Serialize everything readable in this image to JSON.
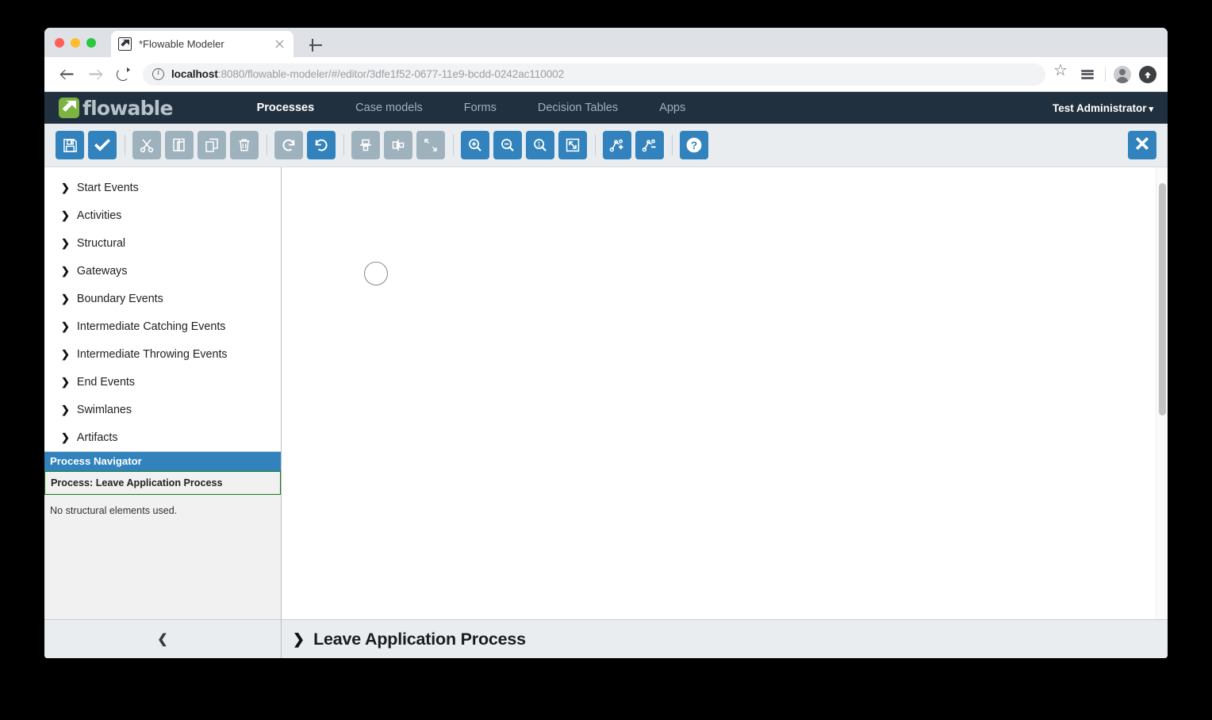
{
  "browser": {
    "tab": {
      "title": "*Flowable Modeler",
      "favicon_icon": "flowable-favicon-icon",
      "close_icon": "close-icon"
    },
    "new_tab_icon": "plus-icon",
    "back_icon": "arrow-left-icon",
    "forward_icon": "arrow-right-icon",
    "reload_icon": "reload-icon",
    "site_info_icon": "info-circle-icon",
    "url_host": "localhost",
    "url_path": ":8080/flowable-modeler/#/editor/3dfe1f52-0677-11e9-bcdd-0242ac110002",
    "bookmark_icon": "star-icon",
    "extension_icon": "extensions-stack-icon",
    "profile_icon": "avatar-icon",
    "update_icon": "update-arrow-icon"
  },
  "navbar": {
    "logo_text": "flowable",
    "logo_icon": "flowable-logo-icon",
    "items": [
      {
        "label": "Processes",
        "active": true
      },
      {
        "label": "Case models",
        "active": false
      },
      {
        "label": "Forms",
        "active": false
      },
      {
        "label": "Decision Tables",
        "active": false
      },
      {
        "label": "Apps",
        "active": false
      }
    ],
    "user": "Test Administrator",
    "user_caret_icon": "chevron-down-icon",
    "background_color": "#21303f",
    "accent_color": "#7cb342"
  },
  "toolbar": {
    "enabled_color": "#3182bd",
    "disabled_color": "#9eb2bd",
    "background_color": "#e9edf0",
    "buttons": [
      {
        "name": "save-button",
        "icon": "floppy-disk-icon",
        "enabled": true,
        "title": "Save"
      },
      {
        "name": "validate-button",
        "icon": "check-icon",
        "enabled": true,
        "title": "Validate"
      },
      {
        "separator": true
      },
      {
        "name": "cut-button",
        "icon": "scissors-icon",
        "enabled": false,
        "title": "Cut"
      },
      {
        "name": "copy-button",
        "icon": "copy-icon",
        "enabled": false,
        "title": "Copy"
      },
      {
        "name": "paste-button",
        "icon": "paste-icon",
        "enabled": false,
        "title": "Paste"
      },
      {
        "name": "delete-button",
        "icon": "trash-icon",
        "enabled": false,
        "title": "Delete"
      },
      {
        "separator": true
      },
      {
        "name": "redo-button",
        "icon": "redo-arrow-icon",
        "enabled": false,
        "title": "Redo"
      },
      {
        "name": "undo-button",
        "icon": "undo-arrow-icon",
        "enabled": true,
        "title": "Undo"
      },
      {
        "separator": true
      },
      {
        "name": "align-vertical-button",
        "icon": "align-vertical-icon",
        "enabled": false,
        "title": "Align vertical"
      },
      {
        "name": "align-horizontal-button",
        "icon": "align-horizontal-icon",
        "enabled": false,
        "title": "Align horizontal"
      },
      {
        "name": "same-size-button",
        "icon": "resize-same-size-icon",
        "enabled": false,
        "title": "Same size"
      },
      {
        "separator": true
      },
      {
        "name": "zoom-in-button",
        "icon": "magnifier-plus-icon",
        "enabled": true,
        "title": "Zoom in"
      },
      {
        "name": "zoom-out-button",
        "icon": "magnifier-minus-icon",
        "enabled": true,
        "title": "Zoom out"
      },
      {
        "name": "zoom-actual-button",
        "icon": "magnifier-one-icon",
        "enabled": true,
        "title": "Zoom actual size"
      },
      {
        "name": "zoom-fit-button",
        "icon": "fit-to-screen-icon",
        "enabled": true,
        "title": "Zoom fit to screen"
      },
      {
        "separator": true
      },
      {
        "name": "add-bendpoint-button",
        "icon": "bendpoint-plus-icon",
        "enabled": true,
        "title": "Add bendpoint"
      },
      {
        "name": "remove-bendpoint-button",
        "icon": "bendpoint-minus-icon",
        "enabled": true,
        "title": "Remove bendpoint"
      },
      {
        "separator": true
      },
      {
        "name": "help-button",
        "icon": "question-circle-icon",
        "enabled": true,
        "title": "Help"
      }
    ],
    "close": {
      "name": "close-editor-button",
      "icon": "x-icon",
      "title": "Close editor"
    }
  },
  "palette": {
    "groups": [
      {
        "label": "Start Events",
        "icon": "chevron-right-icon"
      },
      {
        "label": "Activities",
        "icon": "chevron-right-icon"
      },
      {
        "label": "Structural",
        "icon": "chevron-right-icon"
      },
      {
        "label": "Gateways",
        "icon": "chevron-right-icon"
      },
      {
        "label": "Boundary Events",
        "icon": "chevron-right-icon"
      },
      {
        "label": "Intermediate Catching Events",
        "icon": "chevron-right-icon"
      },
      {
        "label": "Intermediate Throwing Events",
        "icon": "chevron-right-icon"
      },
      {
        "label": "End Events",
        "icon": "chevron-right-icon"
      },
      {
        "label": "Swimlanes",
        "icon": "chevron-right-icon"
      },
      {
        "label": "Artifacts",
        "icon": "chevron-right-icon"
      }
    ],
    "navigator": {
      "header": "Process Navigator",
      "header_color": "#3182bd",
      "selected_item": "Process: Leave Application Process",
      "selected_border_color": "#1a7a1a",
      "empty_message": "No structural elements used."
    },
    "collapse_icon": "chevron-left-icon"
  },
  "canvas": {
    "elements": [
      {
        "name": "start-event-shape",
        "type": "bpmn-start-event",
        "shape": "circle"
      }
    ],
    "scrollbar": {
      "name": "canvas-vertical-scrollbar",
      "thumb": "scroll-thumb"
    }
  },
  "process_bar": {
    "expand_icon": "chevron-right-icon",
    "title": "Leave Application Process"
  }
}
